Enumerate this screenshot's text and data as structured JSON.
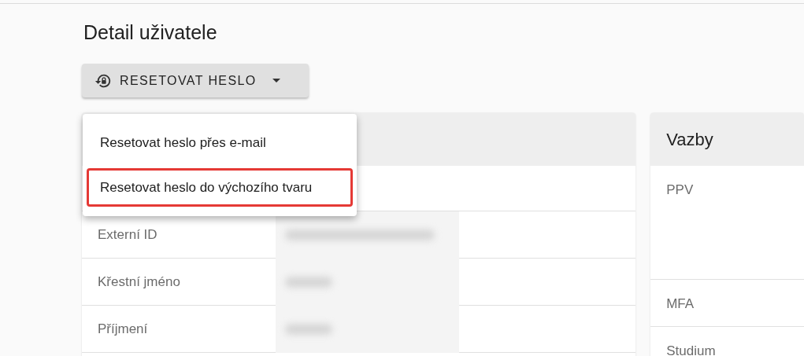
{
  "page": {
    "title": "Detail uživatele"
  },
  "reset_button": {
    "label": "RESETOVAT HESLO",
    "expanded": true
  },
  "menu": {
    "items": [
      {
        "label": "Resetovat heslo přes e-mail",
        "highlighted": false
      },
      {
        "label": "Resetovat heslo do výchozího tvaru",
        "highlighted": true
      }
    ]
  },
  "detail_card": {
    "rows": [
      {
        "label": "Externí ID",
        "value_blurred": true
      },
      {
        "label": "Křestní jméno",
        "value_blurred": true
      },
      {
        "label": "Příjmení",
        "value_blurred": true
      }
    ]
  },
  "relations_card": {
    "title": "Vazby",
    "rows": [
      {
        "label": "PPV",
        "kind": "tall"
      },
      {
        "label": "MFA",
        "kind": "normal"
      },
      {
        "label": "Studium",
        "kind": "normal"
      }
    ]
  }
}
